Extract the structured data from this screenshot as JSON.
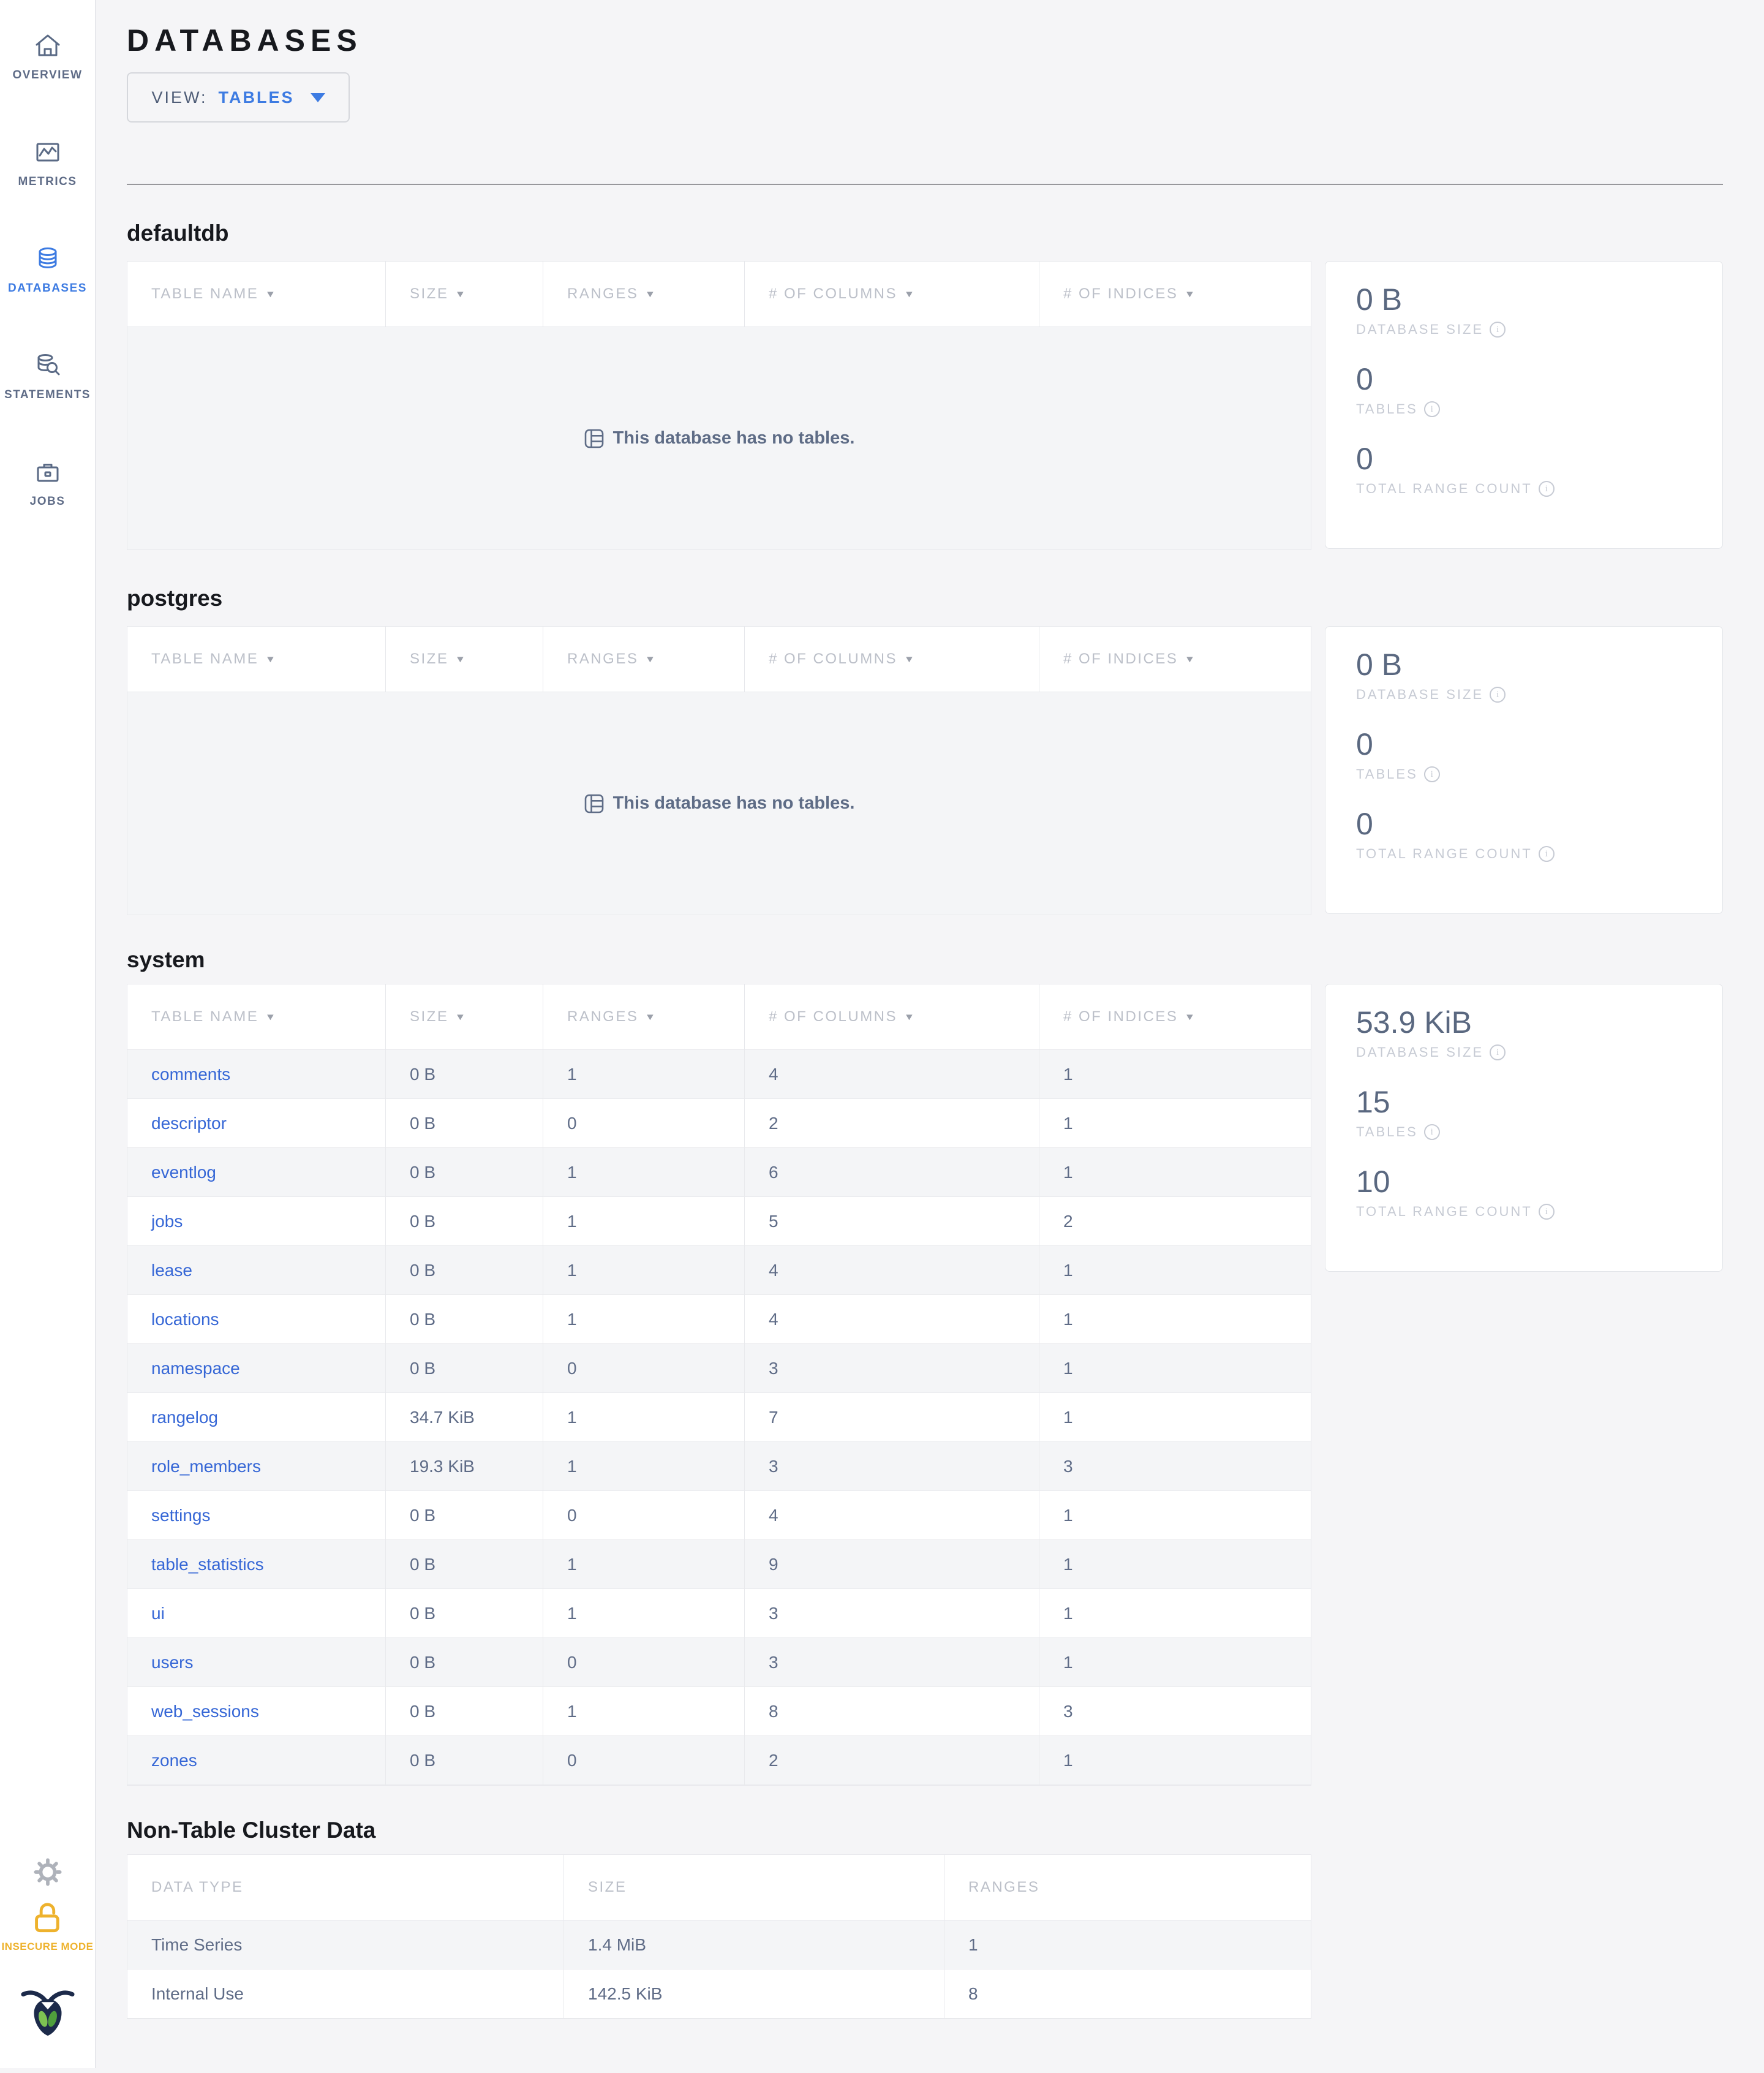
{
  "colors": {
    "accent_blue": "#3D7BE2",
    "link_blue": "#3667D6",
    "slate": "#5F6C87",
    "insecure_yellow": "#EEB22D",
    "logo_navy": "#1C2A4A",
    "row_stripe": "#F4F5F7"
  },
  "sidebar": {
    "items": [
      {
        "label": "OVERVIEW",
        "icon": "home-icon",
        "active": false
      },
      {
        "label": "METRICS",
        "icon": "metrics-icon",
        "active": false
      },
      {
        "label": "DATABASES",
        "icon": "database-icon",
        "active": true
      },
      {
        "label": "STATEMENTS",
        "icon": "statements-icon",
        "active": false
      },
      {
        "label": "JOBS",
        "icon": "jobs-icon",
        "active": false
      }
    ],
    "settings_icon": "gear-icon",
    "insecure_label": "INSECURE MODE",
    "logo_icon": "cockroachdb-logo"
  },
  "header": {
    "title": "DATABASES",
    "view_label": "VIEW:",
    "view_value": "TABLES"
  },
  "table_headers": {
    "main": [
      "TABLE NAME",
      "SIZE",
      "RANGES",
      "# OF COLUMNS",
      "# OF INDICES"
    ],
    "nontable": [
      "DATA TYPE",
      "SIZE",
      "RANGES"
    ]
  },
  "stats_labels": {
    "size": "DATABASE SIZE",
    "tables": "TABLES",
    "ranges": "TOTAL RANGE COUNT"
  },
  "sections": [
    {
      "heading": "defaultdb",
      "empty_text": "This database has no tables.",
      "stats": {
        "size": "0 B",
        "tables": "0",
        "ranges": "0"
      }
    },
    {
      "heading": "postgres",
      "empty_text": "This database has no tables.",
      "stats": {
        "size": "0 B",
        "tables": "0",
        "ranges": "0"
      }
    },
    {
      "heading": "system",
      "stats": {
        "size": "53.9 KiB",
        "tables": "15",
        "ranges": "10"
      },
      "rows": [
        [
          "comments",
          "0 B",
          "1",
          "4",
          "1"
        ],
        [
          "descriptor",
          "0 B",
          "0",
          "2",
          "1"
        ],
        [
          "eventlog",
          "0 B",
          "1",
          "6",
          "1"
        ],
        [
          "jobs",
          "0 B",
          "1",
          "5",
          "2"
        ],
        [
          "lease",
          "0 B",
          "1",
          "4",
          "1"
        ],
        [
          "locations",
          "0 B",
          "1",
          "4",
          "1"
        ],
        [
          "namespace",
          "0 B",
          "0",
          "3",
          "1"
        ],
        [
          "rangelog",
          "34.7 KiB",
          "1",
          "7",
          "1"
        ],
        [
          "role_members",
          "19.3 KiB",
          "1",
          "3",
          "3"
        ],
        [
          "settings",
          "0 B",
          "0",
          "4",
          "1"
        ],
        [
          "table_statistics",
          "0 B",
          "1",
          "9",
          "1"
        ],
        [
          "ui",
          "0 B",
          "1",
          "3",
          "1"
        ],
        [
          "users",
          "0 B",
          "0",
          "3",
          "1"
        ],
        [
          "web_sessions",
          "0 B",
          "1",
          "8",
          "3"
        ],
        [
          "zones",
          "0 B",
          "0",
          "2",
          "1"
        ]
      ]
    }
  ],
  "non_table": {
    "heading": "Non-Table Cluster Data",
    "rows": [
      [
        "Time Series",
        "1.4 MiB",
        "1"
      ],
      [
        "Internal Use",
        "142.5 KiB",
        "8"
      ]
    ]
  }
}
